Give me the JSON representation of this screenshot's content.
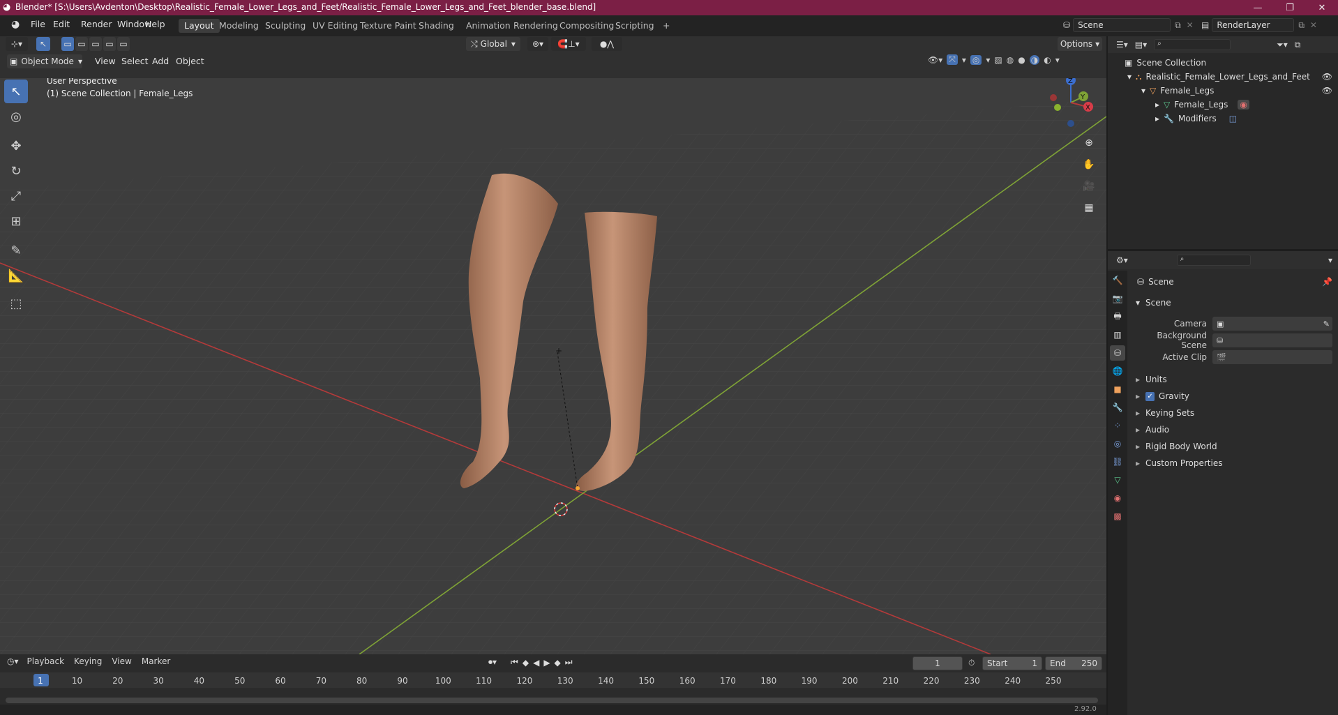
{
  "window": {
    "title": "Blender* [S:\\Users\\Avdenton\\Desktop\\Realistic_Female_Lower_Legs_and_Feet/Realistic_Female_Lower_Legs_and_Feet_blender_base.blend]",
    "minimize": "—",
    "maximize": "❐",
    "close": "✕"
  },
  "menus": [
    "File",
    "Edit",
    "Render",
    "Window",
    "Help"
  ],
  "workspaces": [
    "Layout",
    "Modeling",
    "Sculpting",
    "UV Editing",
    "Texture Paint",
    "Shading",
    "Animation",
    "Rendering",
    "Compositing",
    "Scripting"
  ],
  "workspace_add": "+",
  "scene_field": "Scene",
  "renderlayer_field": "RenderLayer",
  "viewport": {
    "transform_orientation": "Global",
    "options_label": "Options",
    "mode": "Object Mode",
    "header_menus": [
      "View",
      "Select",
      "Add",
      "Object"
    ],
    "overlay_text_1": "User Perspective",
    "overlay_text_2": "(1) Scene Collection | Female_Legs",
    "gizmo": {
      "z": "Z",
      "y": "Y",
      "x": "X"
    }
  },
  "outliner": {
    "root": "Scene Collection",
    "items": [
      {
        "label": "Realistic_Female_Lower_Legs_and_Feet",
        "icon": "collection-icon"
      },
      {
        "label": "Female_Legs",
        "icon": "object-icon"
      },
      {
        "label": "Female_Legs",
        "icon": "mesh-icon"
      },
      {
        "label": "Modifiers",
        "icon": "wrench-icon"
      }
    ]
  },
  "properties": {
    "context_title": "Scene",
    "section": "Scene",
    "fields": [
      {
        "label": "Camera",
        "value": ""
      },
      {
        "label": "Background Scene",
        "value": ""
      },
      {
        "label": "Active Clip",
        "value": ""
      }
    ],
    "panels": [
      "Units",
      "Gravity",
      "Keying Sets",
      "Audio",
      "Rigid Body World",
      "Custom Properties"
    ],
    "gravity_checked": true
  },
  "timeline": {
    "menus": [
      "Playback",
      "Keying",
      "View",
      "Marker"
    ],
    "current_frame": "1",
    "start_label": "Start",
    "start": "1",
    "end_label": "End",
    "end": "250",
    "ticks": [
      "1",
      "10",
      "20",
      "30",
      "40",
      "50",
      "60",
      "70",
      "80",
      "90",
      "100",
      "110",
      "120",
      "130",
      "140",
      "150",
      "160",
      "170",
      "180",
      "190",
      "200",
      "210",
      "220",
      "230",
      "240",
      "250"
    ]
  },
  "status": {
    "version": "2.92.0"
  },
  "colors": {
    "title_bar": "#7b1f45",
    "accent": "#4772b3",
    "x_axis": "#b43a3a",
    "y_axis": "#7fa336"
  }
}
